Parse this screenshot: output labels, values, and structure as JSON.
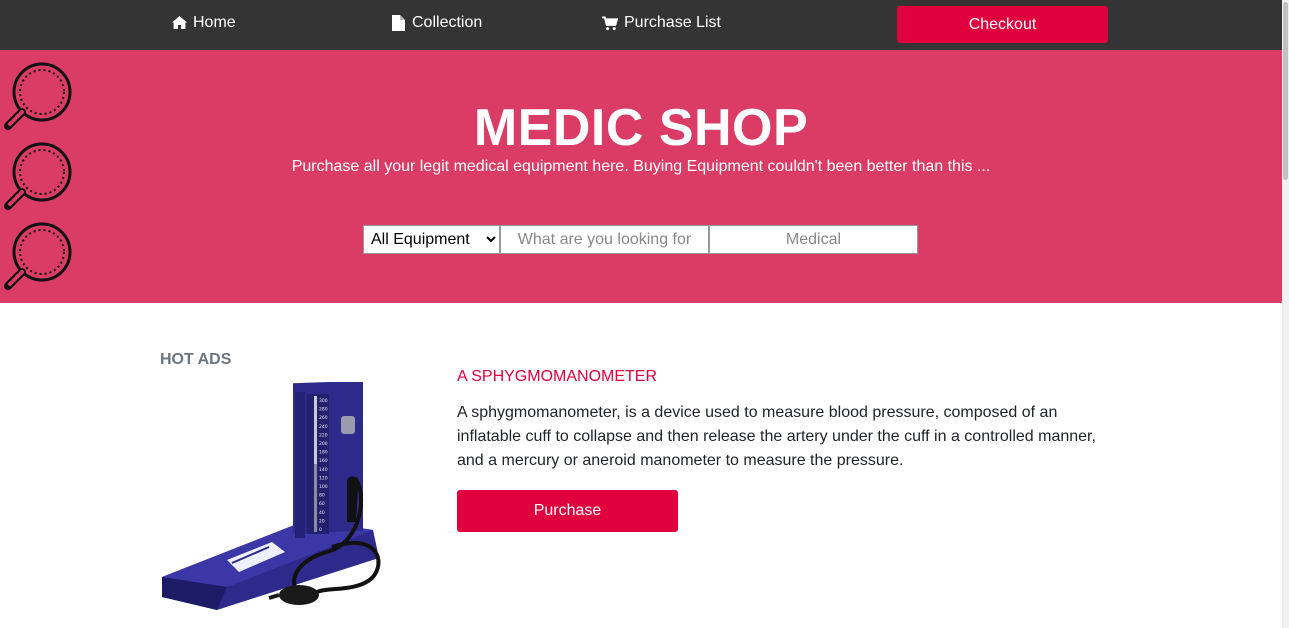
{
  "nav": {
    "home": "Home",
    "collection": "Collection",
    "purchase_list": "Purchase List",
    "checkout": "Checkout"
  },
  "hero": {
    "title": "MEDIC SHOP",
    "subtitle": "Purchase all your legit medical equipment here. Buying Equipment couldn't been better than this ..."
  },
  "search": {
    "category_selected": "All Equipment",
    "query_placeholder": "What are you looking for",
    "tag_placeholder": "Medical"
  },
  "hot_ads": {
    "label": "HOT ADS"
  },
  "product": {
    "title": "A SPHYGMOMANOMETER",
    "description": "A sphygmomanometer, is a device used to measure blood pressure, composed of an inflatable cuff to collapse and then release the artery under the cuff in a controlled manner, and a mercury or aneroid manometer to measure the pressure.",
    "purchase_label": "Purchase",
    "gauge_ticks": [
      "300",
      "280",
      "260",
      "240",
      "220",
      "200",
      "180",
      "160",
      "140",
      "120",
      "100",
      "80",
      "60",
      "40",
      "20",
      "0"
    ]
  },
  "colors": {
    "nav_bg": "#343434",
    "hero_bg": "#db3c65",
    "accent": "#e0003e",
    "device_blue": "#2e2a8c"
  }
}
